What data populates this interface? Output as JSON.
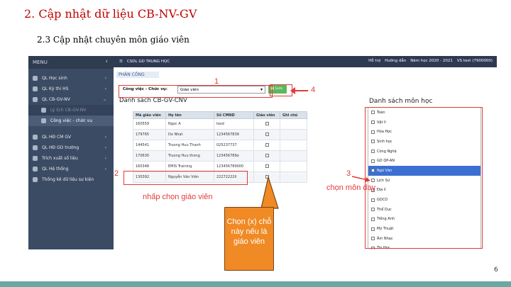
{
  "slide": {
    "title": "2. Cập nhật dữ liệu CB-NV-GV",
    "subtitle": "2.3 Cập nhật chuyên môn giáo viên",
    "page_number": "6"
  },
  "sidebar": {
    "header": "MENU",
    "items": [
      {
        "label": "QL Học sinh"
      },
      {
        "label": "QL Kỳ thi HS"
      },
      {
        "label": "QL CB-GV-NV"
      },
      {
        "label": "Lý lịch CB-GV-NV"
      },
      {
        "label": "Công việc - chức vụ"
      },
      {
        "label": "QL HĐ CM GV"
      },
      {
        "label": "QL HĐ GD trường"
      },
      {
        "label": "Trích xuất số liệu"
      },
      {
        "label": "QL Hệ thống"
      },
      {
        "label": "Thống kê dữ liệu sự kiện"
      }
    ]
  },
  "topbar": {
    "app": "CSDL GD TRUNG HỌC",
    "support": "Hỗ trợ",
    "guide": "Hướng dẫn",
    "year": "Năm học 2020 - 2021",
    "user": "VS test (7900000)"
  },
  "panel": {
    "tab": "PHÂN CÔNG",
    "job_label": "Công việc - Chức vụ:",
    "job_value": "Giáo viên",
    "save": "Lưu",
    "list_title": "Danh sách CB-GV-CNV"
  },
  "table": {
    "headers": [
      "Mã giáo viên",
      "Họ tên",
      "Số CMND",
      "Giáo viên",
      "Ghi chú"
    ],
    "rows": [
      [
        "160559",
        "Ngọc A",
        "tesd",
        "",
        ""
      ],
      [
        "179765",
        "Do Nhat",
        "1234567839",
        "",
        ""
      ],
      [
        "144541",
        "Truong Huu Thanh",
        "025237737",
        "",
        ""
      ],
      [
        "170630",
        "Truong Huu thong",
        "123456789o",
        "",
        ""
      ],
      [
        "160348",
        "EMIS Training",
        "123456789000",
        "",
        ""
      ],
      [
        "130392",
        "Nguyễn Văn Viên",
        "22272222ll",
        "",
        ""
      ]
    ]
  },
  "subjects": {
    "title": "Danh sách môn học",
    "items": [
      "Toán",
      "Vật lí",
      "Hóa Học",
      "Sinh học",
      "Công Nghệ",
      "GD QP-AN",
      "Ngữ Văn",
      "Lịch Sử",
      "Địa lí",
      "GDCD",
      "Thể Dục",
      "Tiếng Anh",
      "Mỹ Thuật",
      "Âm Nhạc",
      "Tin Học",
      "Toán 10"
    ],
    "selected_index": 6
  },
  "annotations": {
    "n1": "1",
    "n2": "2",
    "n3": "3",
    "n4": "4",
    "pick_teacher": "nhấp chọn giáo viên",
    "pick_subject": "chọn môn dạy",
    "callout": "Chọn (x) chỗ này nếu là giáo viên"
  }
}
